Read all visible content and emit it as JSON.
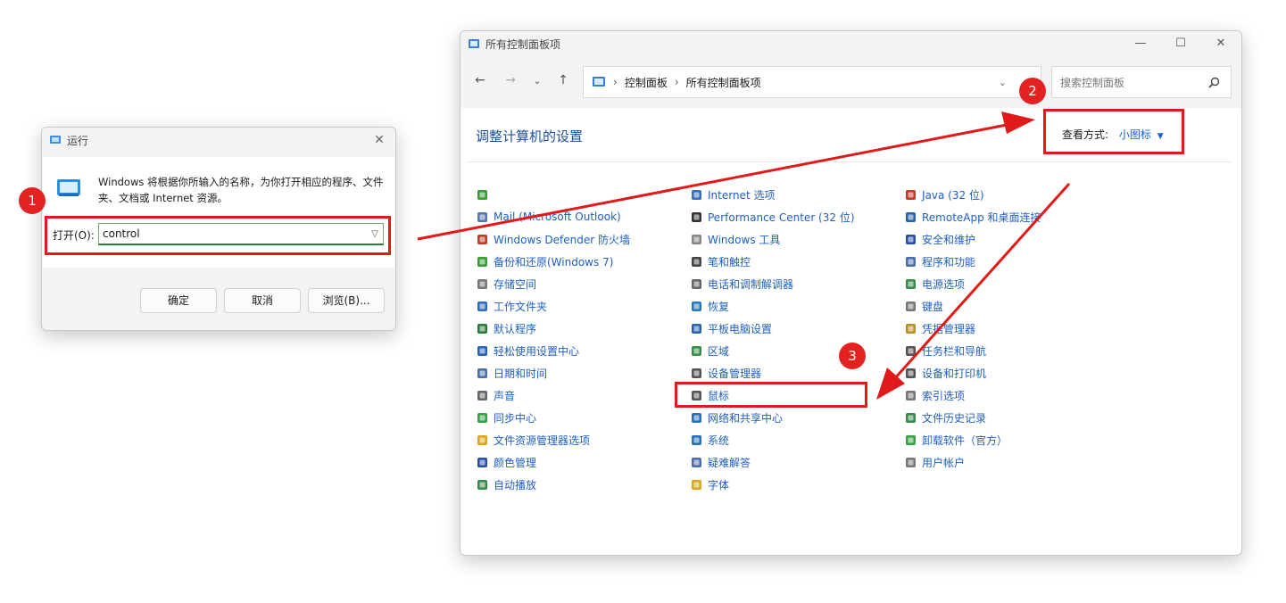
{
  "run_dialog": {
    "title": "运行",
    "close": "✕",
    "description": "Windows 将根据你所输入的名称，为你打开相应的程序、文件夹、文档或 Internet 资源。",
    "open_label": "打开(O):",
    "open_value": "control",
    "ok": "确定",
    "cancel": "取消",
    "browse": "浏览(B)..."
  },
  "control_panel": {
    "title": "所有控制面板项",
    "minimize": "—",
    "maximize": "☐",
    "close": "✕",
    "breadcrumb": [
      "控制面板",
      "所有控制面板项"
    ],
    "breadcrumb_sep": "›",
    "search_placeholder": "搜索控制面板",
    "heading": "调整计算机的设置",
    "view_by_label": "查看方式:",
    "view_by_value": "小图标",
    "columns": [
      [
        {
          "label": "",
          "icon": "network-icon",
          "color": "#3a9a3a"
        },
        {
          "label": "Mail (Microsoft Outlook)",
          "icon": "mail-icon",
          "color": "#5577aa"
        },
        {
          "label": "Windows Defender 防火墙",
          "icon": "firewall-icon",
          "color": "#b8402a"
        },
        {
          "label": "备份和还原(Windows 7)",
          "icon": "backup-icon",
          "color": "#3a9a3a"
        },
        {
          "label": "存储空间",
          "icon": "storage-icon",
          "color": "#777777"
        },
        {
          "label": "工作文件夹",
          "icon": "work-folders-icon",
          "color": "#2f6fb8"
        },
        {
          "label": "默认程序",
          "icon": "default-programs-icon",
          "color": "#2a7a3a"
        },
        {
          "label": "轻松使用设置中心",
          "icon": "ease-of-access-icon",
          "color": "#2a62b8"
        },
        {
          "label": "日期和时间",
          "icon": "clock-icon",
          "color": "#4a6fa8"
        },
        {
          "label": "声音",
          "icon": "speaker-icon",
          "color": "#666666"
        },
        {
          "label": "同步中心",
          "icon": "sync-icon",
          "color": "#3aa04a"
        },
        {
          "label": "文件资源管理器选项",
          "icon": "folder-options-icon",
          "color": "#d8a820"
        },
        {
          "label": "颜色管理",
          "icon": "color-management-icon",
          "color": "#2a4fa0"
        },
        {
          "label": "自动播放",
          "icon": "autoplay-icon",
          "color": "#3a8a4a"
        }
      ],
      [
        {
          "label": "Internet 选项",
          "icon": "internet-options-icon",
          "color": "#3a6fb8"
        },
        {
          "label": "Performance Center (32 位)",
          "icon": "performance-icon",
          "color": "#333333"
        },
        {
          "label": "Windows 工具",
          "icon": "tools-icon",
          "color": "#888888"
        },
        {
          "label": "笔和触控",
          "icon": "pen-icon",
          "color": "#444444"
        },
        {
          "label": "电话和调制解调器",
          "icon": "phone-modem-icon",
          "color": "#666666"
        },
        {
          "label": "恢复",
          "icon": "recovery-icon",
          "color": "#2a7ab8"
        },
        {
          "label": "平板电脑设置",
          "icon": "tablet-icon",
          "color": "#2a62a8"
        },
        {
          "label": "区域",
          "icon": "region-icon",
          "color": "#3a8a4a"
        },
        {
          "label": "设备管理器",
          "icon": "device-manager-icon",
          "color": "#555555"
        },
        {
          "label": "鼠标",
          "icon": "mouse-icon",
          "color": "#555555"
        },
        {
          "label": "网络和共享中心",
          "icon": "network-sharing-icon",
          "color": "#2a6fb8"
        },
        {
          "label": "系统",
          "icon": "system-icon",
          "color": "#2a6fb8"
        },
        {
          "label": "疑难解答",
          "icon": "troubleshoot-icon",
          "color": "#4a6fa8"
        },
        {
          "label": "字体",
          "icon": "font-icon",
          "color": "#d8a820"
        }
      ],
      [
        {
          "label": "Java (32 位)",
          "icon": "java-icon",
          "color": "#c0392b"
        },
        {
          "label": "RemoteApp 和桌面连接",
          "icon": "remoteapp-icon",
          "color": "#2a62a8"
        },
        {
          "label": "安全和维护",
          "icon": "flag-icon",
          "color": "#2a4fa0"
        },
        {
          "label": "程序和功能",
          "icon": "programs-icon",
          "color": "#4a6fa8"
        },
        {
          "label": "电源选项",
          "icon": "power-icon",
          "color": "#3a8a4a"
        },
        {
          "label": "键盘",
          "icon": "keyboard-icon",
          "color": "#777777"
        },
        {
          "label": "凭据管理器",
          "icon": "credential-icon",
          "color": "#b8902a"
        },
        {
          "label": "任务栏和导航",
          "icon": "taskbar-icon",
          "color": "#555555"
        },
        {
          "label": "设备和打印机",
          "icon": "printer-icon",
          "color": "#555555"
        },
        {
          "label": "索引选项",
          "icon": "indexing-icon",
          "color": "#777777"
        },
        {
          "label": "文件历史记录",
          "icon": "file-history-icon",
          "color": "#3a8a4a"
        },
        {
          "label": "卸载软件（官方）",
          "icon": "uninstall-icon",
          "color": "#3aa04a"
        },
        {
          "label": "用户帐户",
          "icon": "user-accounts-icon",
          "color": "#777777"
        }
      ]
    ]
  },
  "annotations": {
    "badges": [
      "1",
      "2",
      "3"
    ],
    "accent": "#e01919"
  }
}
